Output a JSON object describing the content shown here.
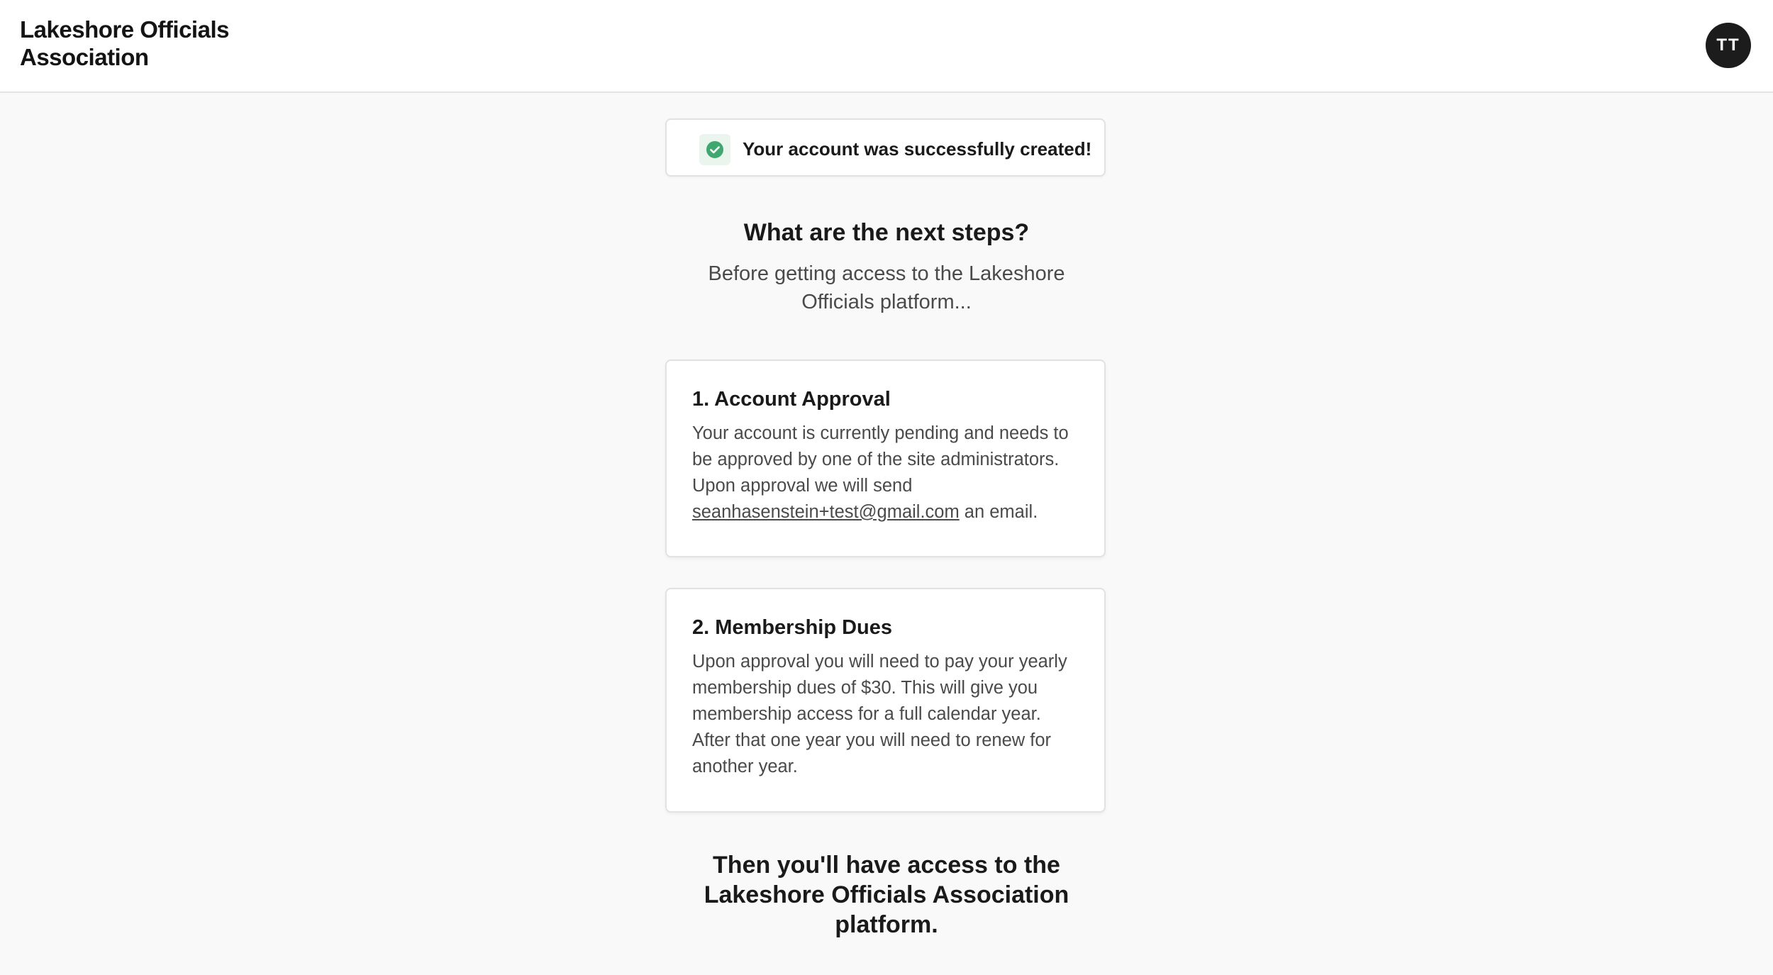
{
  "header": {
    "brand_line1": "Lakeshore Officials",
    "brand_line2": "Association",
    "avatar_initials": "TT"
  },
  "toast": {
    "message": "Your account was successfully created!",
    "icon": "check-circle-icon",
    "icon_color": "#3fa86e"
  },
  "next_steps": {
    "title": "What are the next steps?",
    "subtitle": "Before getting access to the Lakeshore Officials platform..."
  },
  "steps": [
    {
      "title": "1. Account Approval",
      "body_before": "Your account is currently pending and needs to be approved by one of the site administrators. Upon approval we will send ",
      "email": "seanhasenstein+test@gmail.com",
      "body_after": " an email."
    },
    {
      "title": "2. Membership Dues",
      "body": "Upon approval you will need to pay your yearly membership dues of $30. This will give you membership access for a full calendar year. After that one year you will need to renew for another year."
    }
  ],
  "closing": {
    "text": "Then you'll have access to the Lakeshore Officials Association platform."
  }
}
